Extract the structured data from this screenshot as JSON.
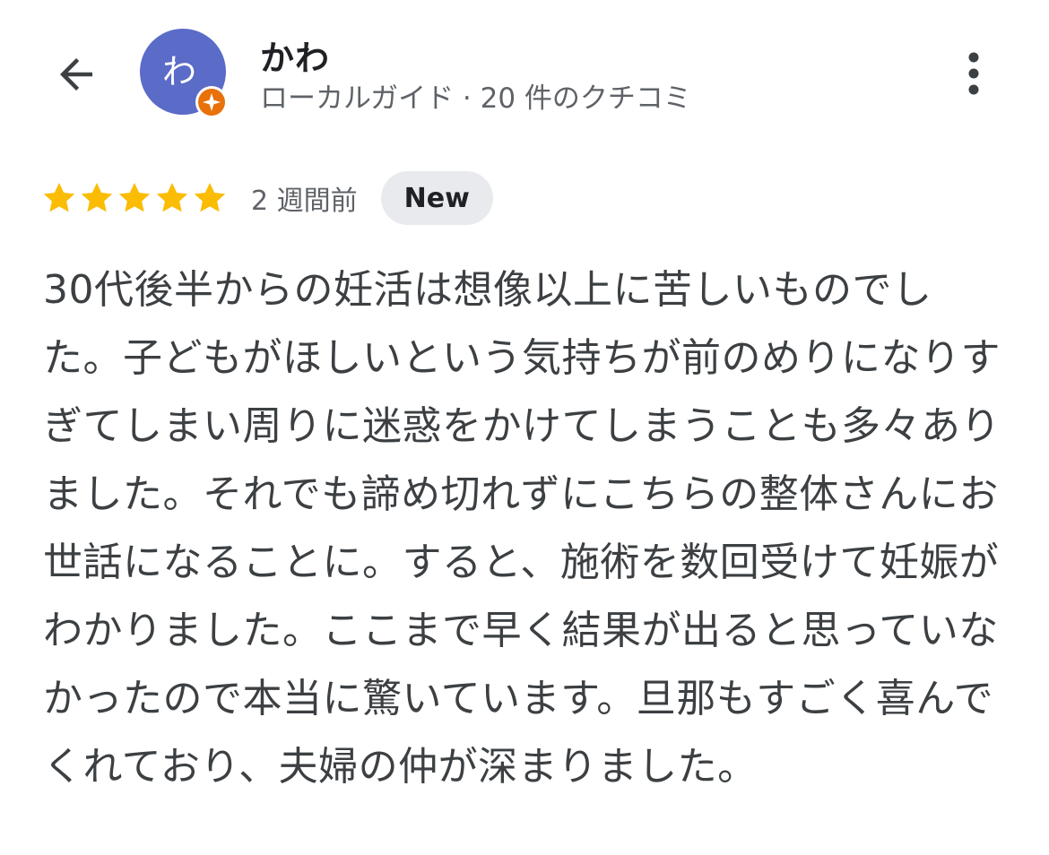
{
  "header": {
    "avatar_initial": "わ",
    "user_name": "かわ",
    "user_meta": "ローカルガイド · 20 件のクチコミ"
  },
  "review": {
    "rating": 5,
    "rating_max": 5,
    "time_ago": "2 週間前",
    "badge": "New",
    "text": "30代後半からの妊活は想像以上に苦しいものでした。子どもがほしいという気持ちが前のめりになりすぎてしまい周りに迷惑をかけてしまうことも多々ありました。それでも諦め切れずにこちらの整体さんにお世話になることに。すると、施術を数回受けて妊娠がわかりました。ここまで早く結果が出ると思っていなかったので本当に驚いています。旦那もすごく喜んでくれており、夫婦の仲が深まりました。"
  },
  "icons": {
    "back": "arrow-back-icon",
    "more": "more-vert-icon",
    "guide_badge": "local-guide-badge-icon",
    "star": "star-icon"
  },
  "colors": {
    "avatar_bg": "#5b6bc8",
    "guide_badge": "#e8710a",
    "star": "#fbbc04",
    "badge_bg": "#e8eaed"
  }
}
